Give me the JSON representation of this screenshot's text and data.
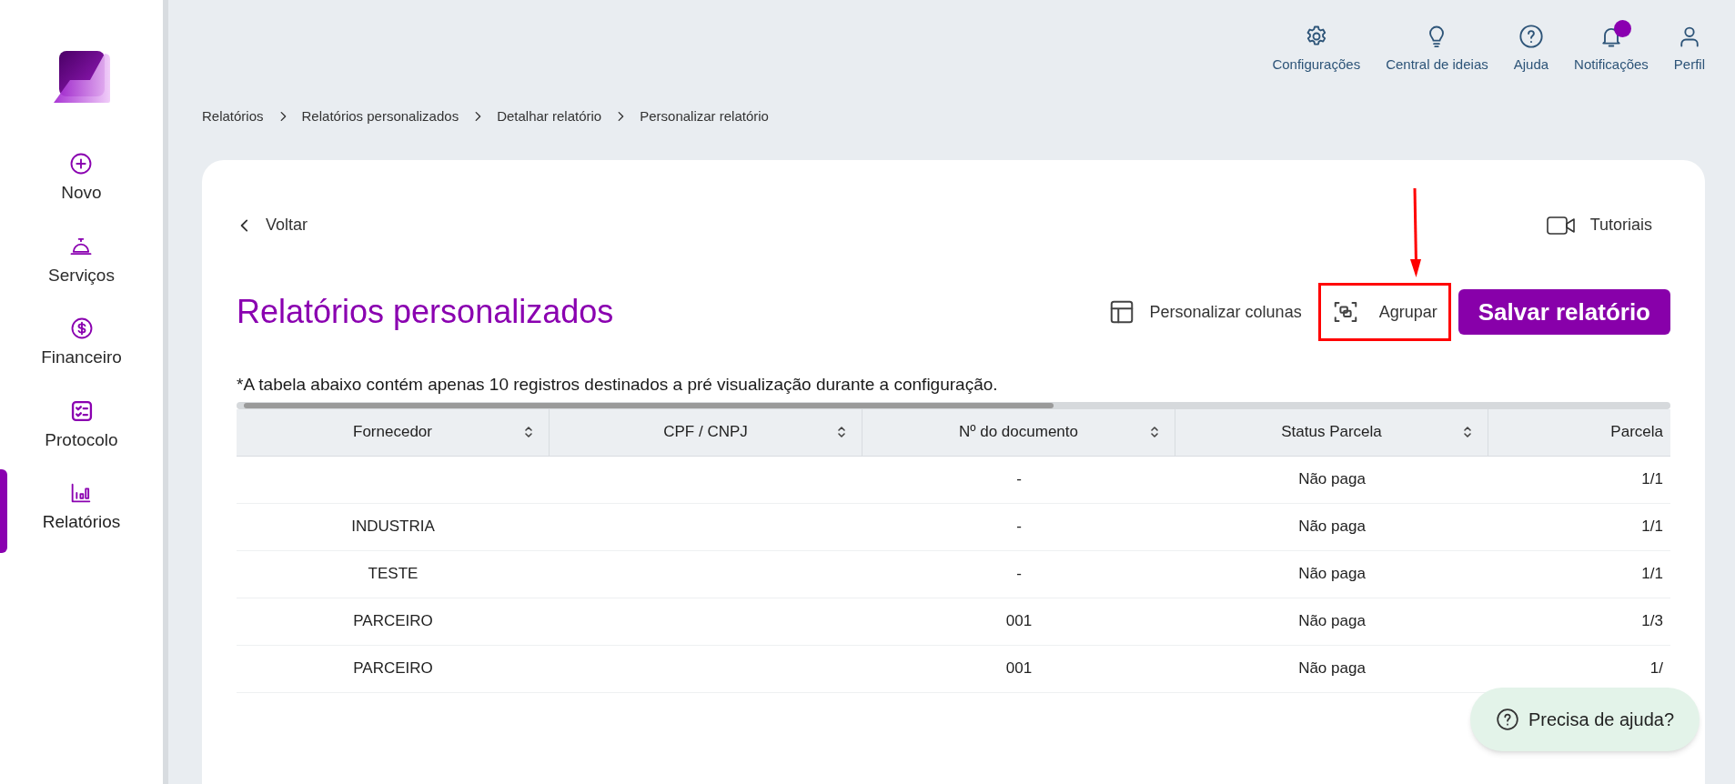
{
  "sidebar": {
    "items": [
      {
        "kind": "plus",
        "label": "Novo",
        "selected": false
      },
      {
        "kind": "bell",
        "label": "Serviços",
        "selected": false
      },
      {
        "kind": "dollar",
        "label": "Financeiro",
        "selected": false
      },
      {
        "kind": "checklist",
        "label": "Protocolo",
        "selected": false
      },
      {
        "kind": "chart",
        "label": "Relatórios",
        "selected": true
      }
    ]
  },
  "top_bar": {
    "items": [
      {
        "kind": "gear",
        "label": "Configurações"
      },
      {
        "kind": "bulb",
        "label": "Central de ideias"
      },
      {
        "kind": "help",
        "label": "Ajuda"
      },
      {
        "kind": "notification",
        "label": "Notificações",
        "unread": true
      },
      {
        "kind": "user",
        "label": "Perfil"
      }
    ]
  },
  "breadcrumb": [
    "Relatórios",
    "Relatórios personalizados",
    "Detalhar relatório",
    "Personalizar relatório"
  ],
  "back_link": "Voltar",
  "tutorials_link": "Tutoriais",
  "title": "Relatórios personalizados",
  "actions": {
    "customize_columns": "Personalizar colunas",
    "group": "Agrupar",
    "save": "Salvar relatório"
  },
  "note": "*A tabela abaixo contém apenas 10 registros destinados a pré visualização durante a configuração.",
  "table": {
    "columns": [
      "Fornecedor",
      "CPF / CNPJ",
      "Nº do documento",
      "Status Parcela",
      "Parcela"
    ],
    "rows": [
      [
        "",
        "",
        "-",
        "Não paga",
        "1/1"
      ],
      [
        "INDUSTRIA",
        "",
        "-",
        "Não paga",
        "1/1"
      ],
      [
        "TESTE",
        "",
        "-",
        "Não paga",
        "1/1"
      ],
      [
        "PARCEIRO",
        "",
        "001",
        "Não paga",
        "1/3"
      ],
      [
        "PARCEIRO",
        "",
        "001",
        "Não paga",
        "1/"
      ]
    ]
  },
  "help_button": "Precisa de ajuda?"
}
